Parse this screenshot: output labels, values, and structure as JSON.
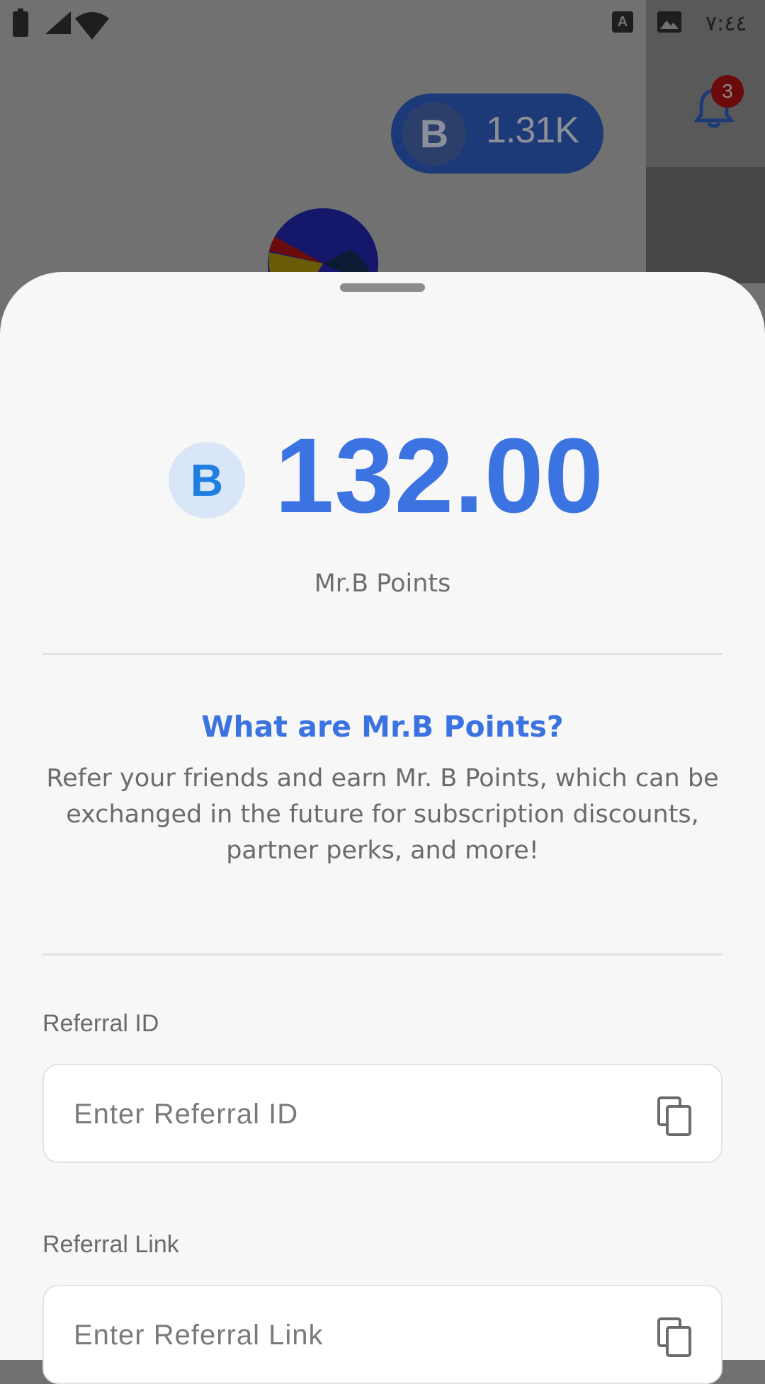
{
  "status_bar": {
    "time": "٧:٤٤",
    "keyboard_indicator": "A",
    "icons": [
      "battery-charging-icon",
      "signal-icon",
      "wifi-icon",
      "keyboard-a-icon",
      "image-icon"
    ]
  },
  "background_app": {
    "points_pill_value": "1.31K",
    "points_logo_letter": "B",
    "notification_count": "3"
  },
  "sheet": {
    "coin_letter": "B",
    "balance": "132.00",
    "balance_caption": "Mr.B Points",
    "faq_title": "What are Mr.B Points?",
    "faq_body": "Refer your friends and earn Mr. B Points, which can be exchanged in the future for subscription discounts, partner perks, and more!",
    "referral_id": {
      "label": "Referral ID",
      "placeholder": "Enter Referral ID",
      "value": ""
    },
    "referral_link": {
      "label": "Referral Link",
      "placeholder": "Enter Referral Link",
      "value": ""
    }
  },
  "colors": {
    "accent": "#3b73e1",
    "sheet_background": "#f7f7f7",
    "scrim": "#717171"
  }
}
